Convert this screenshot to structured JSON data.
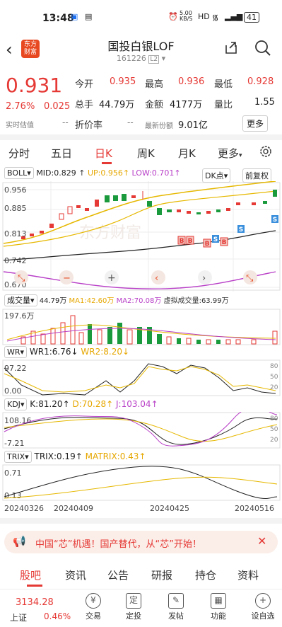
{
  "status": {
    "time": "13:48",
    "net_speed": "5.00\nKB/S",
    "battery": "41"
  },
  "header": {
    "title": "国投白银LOF",
    "code": "161226",
    "code_badge": "L2"
  },
  "quote": {
    "price": "0.931",
    "change_pct": "2.76%",
    "change_amt": "0.025",
    "open_label": "今开",
    "open": "0.935",
    "high_label": "最高",
    "high": "0.936",
    "low_label": "最低",
    "low": "0.928",
    "vol_label": "总手",
    "vol": "44.79万",
    "amount_label": "金额",
    "amount": "4177万",
    "ratio_label": "量比",
    "ratio": "1.55",
    "valuation_label": "实时估值",
    "valuation": "--",
    "discount_label": "折价率",
    "discount": "--",
    "share_label": "最新份额",
    "share": "9.01亿",
    "more": "更多"
  },
  "period_tabs": [
    "分时",
    "五日",
    "日K",
    "周K",
    "月K",
    "更多"
  ],
  "active_tab": "日K",
  "boll": {
    "label": "BOLL",
    "mid": "MID:0.829",
    "up": "UP:0.956",
    "low": "LOW:0.701",
    "dk": "DK点",
    "adj": "前复权",
    "yticks": [
      "0.956",
      "0.885",
      "0.813",
      "0.742",
      "0.670"
    ],
    "markers": [
      "B",
      "B",
      "B",
      "S",
      "B",
      "S",
      "S"
    ],
    "watermark": "东方财富"
  },
  "volume": {
    "label": "成交量",
    "vol": "44.79万",
    "ma1": "MA1:42.60万",
    "ma2": "MA2:70.08万",
    "virtual": "虚拟成交量:63.99万",
    "ytick": "197.6万"
  },
  "wr": {
    "label": "WR",
    "wr1": "WR1:6.76",
    "wr2": "WR2:8.20",
    "yticks": [
      "97.22",
      "0.00"
    ],
    "rticks": [
      "80",
      "50",
      "20"
    ]
  },
  "kdj": {
    "label": "KDJ",
    "k": "K:81.20",
    "d": "D:70.28",
    "j": "J:103.04",
    "yticks": [
      "108.16",
      "-7.21"
    ],
    "rticks": [
      "80",
      "50",
      "20"
    ]
  },
  "trix": {
    "label": "TRIX",
    "trix": "TRIX:0.19",
    "matrix": "MATRIX:0.43",
    "yticks": [
      "0.71",
      "0.13"
    ]
  },
  "dates": [
    "20240326",
    "20240409",
    "20240425",
    "20240516"
  ],
  "banner": {
    "text": "中国“芯”机遇！国产替代，从“芯”开始！"
  },
  "bottom_tabs": [
    "股吧",
    "资讯",
    "公告",
    "研报",
    "持仓",
    "资料"
  ],
  "bottom_bar": {
    "index_value": "3134.28",
    "index_name": "上证",
    "index_pct": "0.46%",
    "items": [
      "交易",
      "定投",
      "发帖",
      "功能",
      "设自选"
    ]
  }
}
